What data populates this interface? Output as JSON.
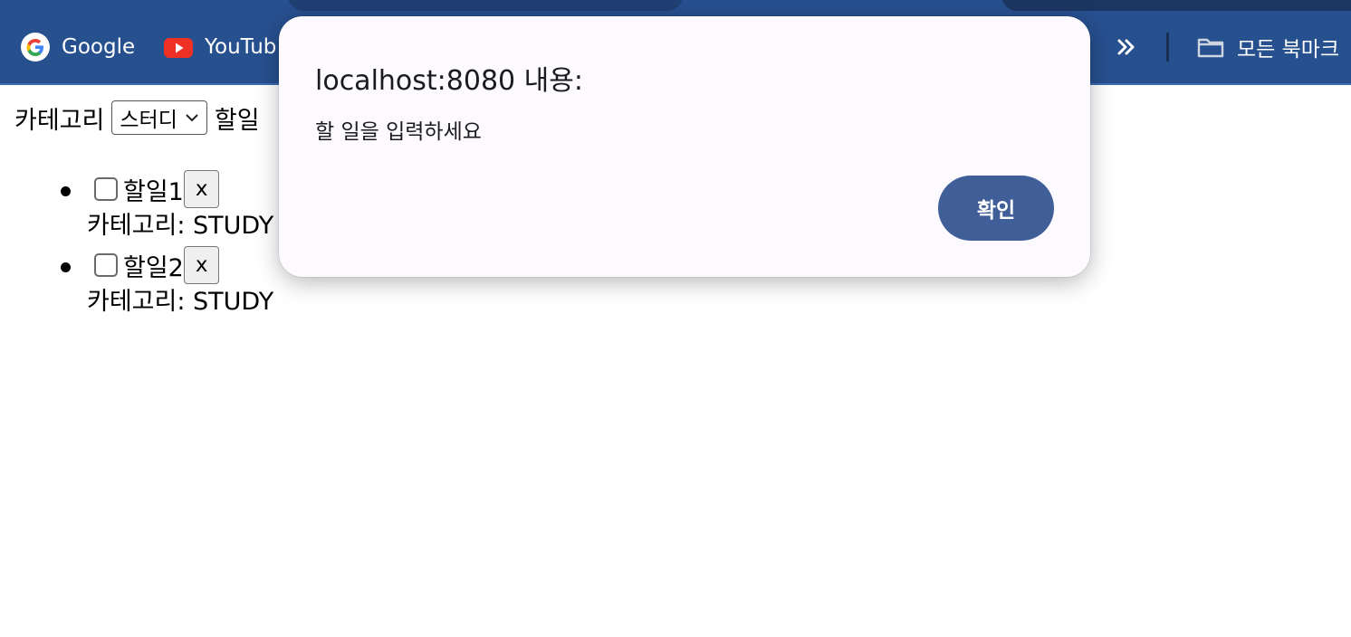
{
  "browser": {
    "bookmarks": [
      {
        "label": "Google",
        "icon": "google-icon"
      },
      {
        "label": "YouTub",
        "icon": "youtube-icon"
      }
    ],
    "more_icon": "chevron-double-right-icon",
    "all_bookmarks_label": "모든 북마크",
    "colors": {
      "toolbar": "#27508f",
      "text": "#ffffff"
    }
  },
  "page": {
    "category_label": "카테고리",
    "category_select_value": "스터디",
    "todo_label": "할일",
    "todos": [
      {
        "title": "할일1",
        "delete_label": "x",
        "category_text": "카테고리: STUDY",
        "checked": false
      },
      {
        "title": "할일2",
        "delete_label": "x",
        "category_text": "카테고리: STUDY",
        "checked": false
      }
    ]
  },
  "dialog": {
    "title": "localhost:8080 내용:",
    "message": "할 일을 입력하세요",
    "ok_label": "확인",
    "colors": {
      "background": "#fcf9ff",
      "button": "#405f98"
    }
  }
}
